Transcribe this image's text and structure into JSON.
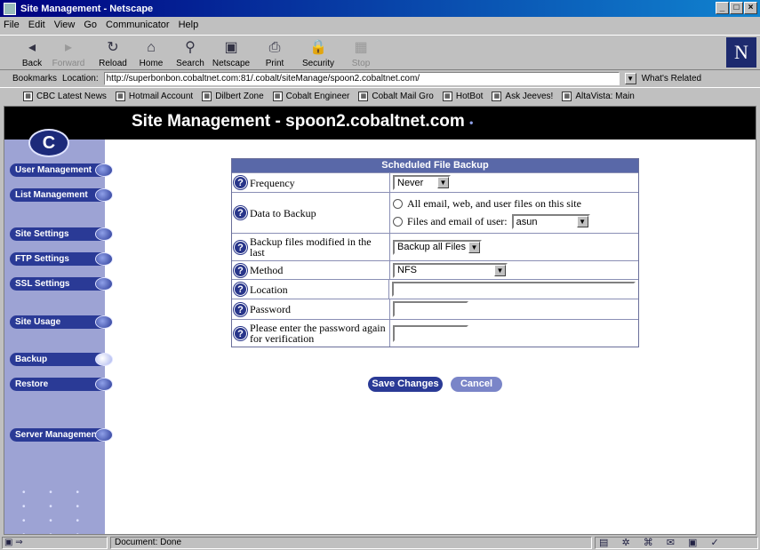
{
  "window": {
    "title": "Site Management - Netscape"
  },
  "menu": [
    "File",
    "Edit",
    "View",
    "Go",
    "Communicator",
    "Help"
  ],
  "toolbar": {
    "buttons": [
      {
        "label": "Back",
        "icon": "◂"
      },
      {
        "label": "Forward",
        "icon": "▸"
      },
      {
        "label": "Reload",
        "icon": "↻"
      },
      {
        "label": "Home",
        "icon": "⌂"
      },
      {
        "label": "Search",
        "icon": "⚲"
      },
      {
        "label": "Netscape",
        "icon": "▣"
      },
      {
        "label": "Print",
        "icon": "⎙"
      },
      {
        "label": "Security",
        "icon": "🔒"
      },
      {
        "label": "Stop",
        "icon": "▦"
      }
    ]
  },
  "location": {
    "bookmarks_label": "Bookmarks",
    "label": "Location:",
    "url": "http://superbonbon.cobaltnet.com:81/.cobalt/siteManage/spoon2.cobaltnet.com/",
    "related": "What's Related"
  },
  "bookmarks": [
    "CBC Latest News",
    "Hotmail Account",
    "Dilbert Zone",
    "Cobalt Engineer",
    "Cobalt Mail Gro",
    "HotBot",
    "Ask Jeeves!",
    "AltaVista: Main"
  ],
  "page": {
    "title": "Site Management - spoon2.cobaltnet.com",
    "title_bullet": "•",
    "logo_glyph": "C",
    "dots": "• • • • • • • • • • • •"
  },
  "sidebar": {
    "items": [
      "User Management",
      "List Management",
      "Site Settings",
      "FTP Settings",
      "SSL Settings",
      "Site Usage",
      "Backup",
      "Restore",
      "Server Management"
    ]
  },
  "form": {
    "title": "Scheduled File Backup",
    "help_glyph": "?",
    "arrow": "▼",
    "frequency": {
      "label": "Frequency",
      "value": "Never"
    },
    "data": {
      "label": "Data to Backup",
      "opt1": "All email, web, and user files on this site",
      "opt2": "Files and email of user:",
      "user": "asun"
    },
    "modified": {
      "label": "Backup files modified in the last",
      "value": "Backup all Files"
    },
    "method": {
      "label": "Method",
      "value": "NFS"
    },
    "location": {
      "label": "Location",
      "value": ""
    },
    "password": {
      "label": "Password",
      "value": ""
    },
    "verify": {
      "label": "Please enter the password again for verification",
      "value": ""
    },
    "save": "Save Changes",
    "cancel": "Cancel"
  },
  "status": {
    "text": "Document: Done",
    "icons": "▤ ✲ ⌘ ✉ ▣ ✓"
  }
}
